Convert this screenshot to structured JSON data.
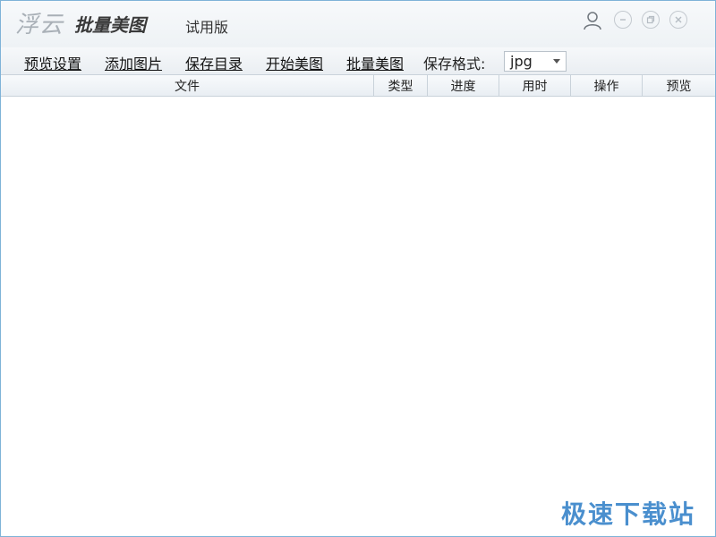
{
  "titlebar": {
    "brand_italic": "浮云",
    "brand_name": "批量美图",
    "edition": "试用版"
  },
  "menubar": {
    "items": [
      "预览设置",
      "添加图片",
      "保存目录",
      "开始美图",
      "批量美图"
    ],
    "format_label": "保存格式:",
    "format_value": "jpg"
  },
  "table": {
    "columns": [
      "文件",
      "类型",
      "进度",
      "用时",
      "操作",
      "预览"
    ],
    "rows": []
  },
  "watermark": "极速下载站",
  "icons": {
    "user": "user-icon",
    "minimize": "minimize-icon",
    "restore": "restore-icon",
    "close": "close-icon",
    "dropdown": "chevron-down-icon"
  },
  "colors": {
    "window_border": "#7fb3d8",
    "watermark": "#4a8fce"
  }
}
